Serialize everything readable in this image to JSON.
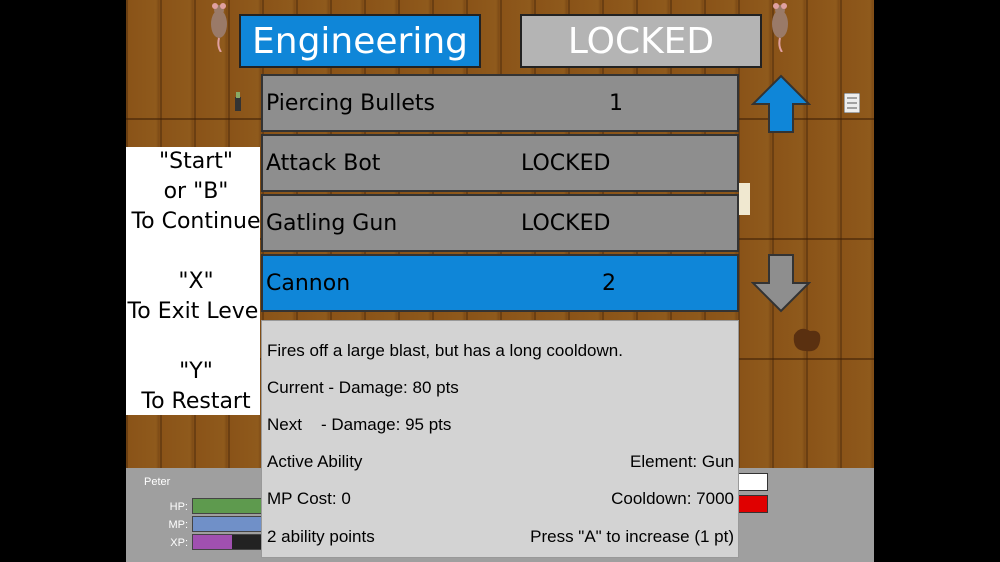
{
  "tabs": {
    "active": "Engineering",
    "locked": "LOCKED"
  },
  "abilities": [
    {
      "name": "Piercing Bullets",
      "value": "1",
      "selected": false
    },
    {
      "name": "Attack Bot",
      "value": "LOCKED",
      "selected": false
    },
    {
      "name": "Gatling Gun",
      "value": "LOCKED",
      "selected": false
    },
    {
      "name": "Cannon",
      "value": "2",
      "selected": true
    }
  ],
  "help": {
    "line1": "\"Start\"",
    "line2": "or \"B\"",
    "line3": "To Continue",
    "line4": "\"X\"",
    "line5": "To Exit Level",
    "line6": "\"Y\"",
    "line7": "To Restart"
  },
  "details": {
    "description": "Fires off a large blast, but has a long cooldown.",
    "current": "Current - Damage: 80 pts",
    "next_label": "Next",
    "next": "- Damage: 95 pts",
    "type": "Active Ability",
    "element": "Element: Gun",
    "mp_cost": "MP Cost: 0",
    "cooldown": "Cooldown: 7000",
    "points": "2 ability points",
    "hint": "Press \"A\" to increase (1 pt)"
  },
  "player": {
    "name": "Peter",
    "hp_label": "HP:",
    "mp_label": "MP:",
    "xp_label": "XP:",
    "hp": 1.0,
    "mp": 1.0,
    "xp": 0.55,
    "colors": {
      "hp": "#5e9a4e",
      "mp": "#7090c8",
      "xp": "#a050b0"
    }
  },
  "colors": {
    "accent": "#0f86d8",
    "locked": "#b4b4b4",
    "row": "#8e8e8e",
    "panel": "#d3d3d3"
  },
  "icons": [
    "up-arrow-icon",
    "down-arrow-icon",
    "rat-icon",
    "bottle-icon",
    "scroll-icon"
  ]
}
